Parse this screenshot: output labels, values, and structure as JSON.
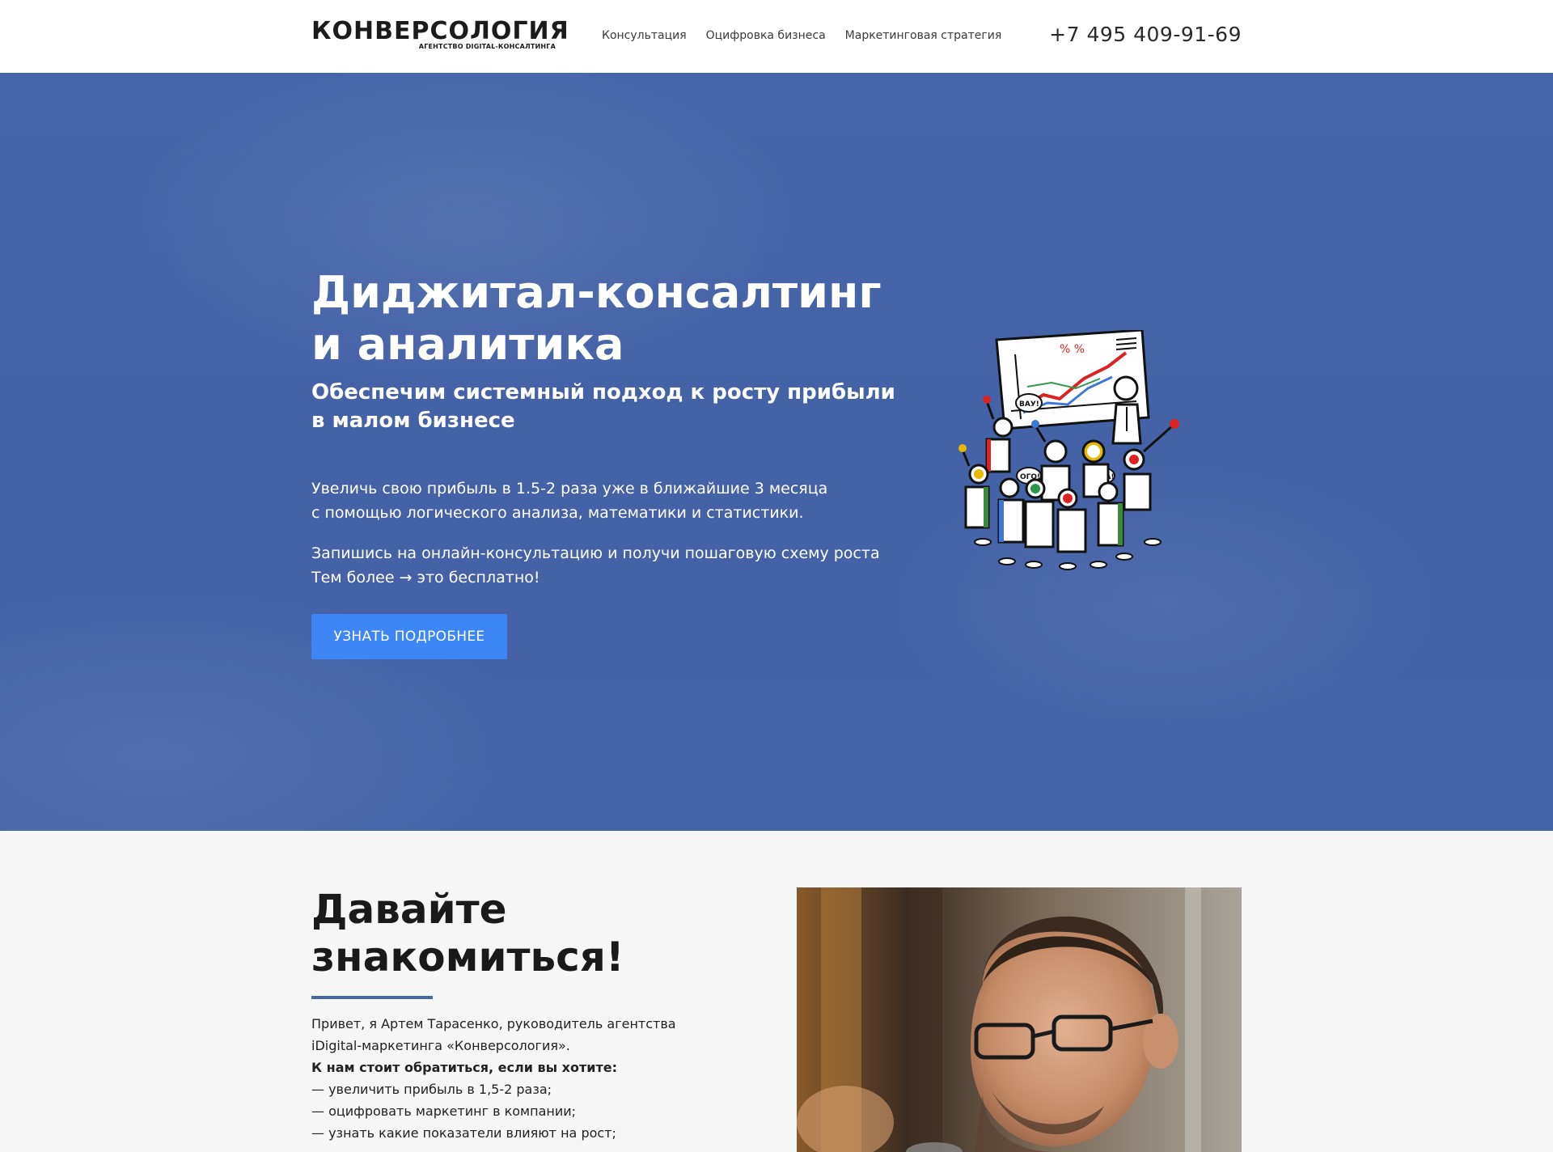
{
  "header": {
    "logo_text": "КОНВЕРСОЛОГИЯ",
    "logo_tagline": "АГЕНТСТВО DIGITAL-КОНСАЛТИНГА",
    "nav": [
      {
        "label": "Консультация"
      },
      {
        "label": "Оцифровка бизнеса"
      },
      {
        "label": "Маркетинговая стратегия"
      }
    ],
    "phone": "+7 495 409-91-69"
  },
  "hero": {
    "title_line1": "Диджитал-консалтинг",
    "title_line2": "и аналитика",
    "subtitle_line1": "Обеспечим системный подход к росту прибыли",
    "subtitle_line2": "в малом бизнесе",
    "p1_line1": "Увеличь свою прибыль в 1.5-2 раза уже в ближайшие 3 месяца",
    "p1_line2": "с помощью логического анализа, математики и статистики.",
    "p2_line1": "Запишись на онлайн-консультацию и получи пошаговую схему роста",
    "p2_line2": "Тем более → это бесплатно!",
    "cta_label": "УЗНАТЬ ПОДРОБНЕЕ",
    "illustration_words": [
      "ВАУ!",
      "ОГО!",
      "УРА!"
    ],
    "illustration_board_text": "% %",
    "background_color": "#4564a7",
    "cta_color": "#3d86f5"
  },
  "about": {
    "title_line1": "Давайте",
    "title_line2": "знакомиться!",
    "intro_line1": "Привет, я Артем Тарасенко, руководитель агентства",
    "intro_line2": "iDigital-маркетинга «Конверсология».",
    "lead": "К нам стоит обратиться, если вы хотите:",
    "bullets": [
      "— увеличить прибыль в 1,5-2 раза;",
      "— оцифровать маркетинг в компании;",
      "— узнать какие показатели влияют на рост;"
    ],
    "accent_color": "#4766a9"
  }
}
